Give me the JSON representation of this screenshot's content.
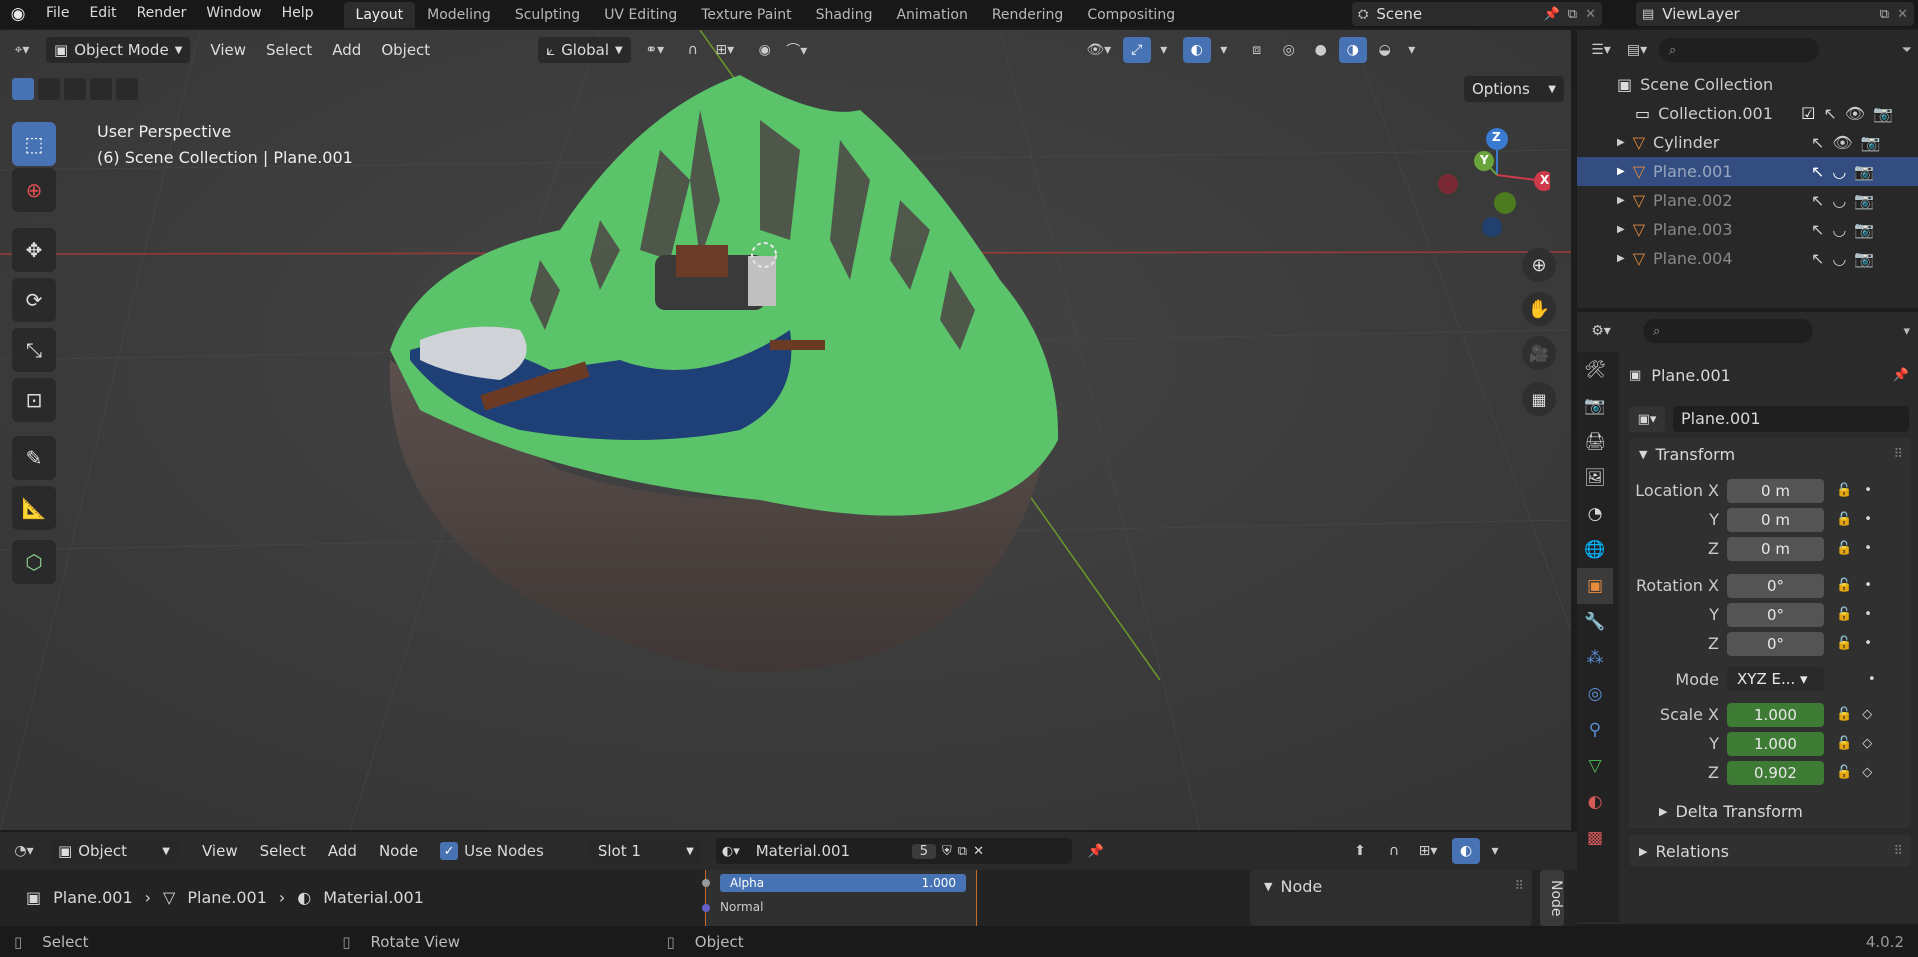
{
  "topbar": {
    "menus": [
      "File",
      "Edit",
      "Render",
      "Window",
      "Help"
    ],
    "workspaces": [
      "Layout",
      "Modeling",
      "Sculpting",
      "UV Editing",
      "Texture Paint",
      "Shading",
      "Animation",
      "Rendering",
      "Compositing"
    ],
    "active_workspace": "Layout",
    "scene": "Scene",
    "view_layer": "ViewLayer"
  },
  "viewport": {
    "mode": "Object Mode",
    "menus": [
      "View",
      "Select",
      "Add",
      "Object"
    ],
    "orientation": "Global",
    "options": "Options",
    "overlay_title": "User Perspective",
    "overlay_sub": "(6) Scene Collection | Plane.001",
    "gizmo": {
      "z": "Z",
      "y": "Y",
      "x": "X"
    }
  },
  "outliner": {
    "root": "Scene Collection",
    "items": [
      {
        "name": "Collection.001",
        "type": "collection"
      },
      {
        "name": "Cylinder",
        "type": "mesh"
      },
      {
        "name": "Plane.001",
        "type": "mesh",
        "selected": true
      },
      {
        "name": "Plane.002",
        "type": "mesh"
      },
      {
        "name": "Plane.003",
        "type": "mesh"
      },
      {
        "name": "Plane.004",
        "type": "mesh"
      }
    ]
  },
  "properties": {
    "object_name": "Plane.001",
    "data_name": "Plane.001",
    "transform_label": "Transform",
    "location": {
      "label": "Location X",
      "x": "0 m",
      "y": "0 m",
      "z": "0 m"
    },
    "rotation": {
      "label": "Rotation X",
      "x": "0°",
      "y": "0°",
      "z": "0°"
    },
    "mode_label": "Mode",
    "mode_value": "XYZ E...",
    "scale": {
      "label": "Scale X",
      "x": "1.000",
      "y": "1.000",
      "z": "0.902"
    },
    "axis_y": "Y",
    "axis_z": "Z",
    "delta": "Delta Transform",
    "relations": "Relations"
  },
  "node_editor": {
    "type": "Object",
    "menus": [
      "View",
      "Select",
      "Add",
      "Node"
    ],
    "use_nodes": "Use Nodes",
    "slot": "Slot 1",
    "material": "Material.001",
    "users": "5",
    "breadcrumb": [
      "Plane.001",
      "Plane.001",
      "Material.001"
    ],
    "socket_alpha": "Alpha",
    "socket_alpha_value": "1.000",
    "socket_normal": "Normal",
    "panel_title": "Node",
    "side_tab": "Node"
  },
  "statusbar": {
    "items": [
      "Select",
      "Rotate View",
      "Object"
    ],
    "version": "4.0.2"
  }
}
